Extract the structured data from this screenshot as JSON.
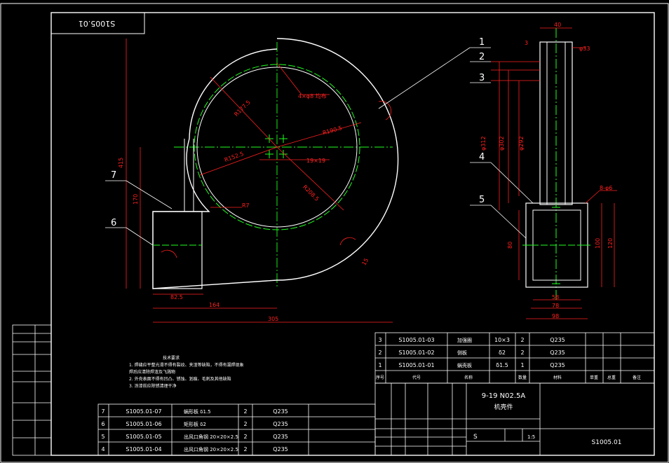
{
  "title_block_flipped": "S1005.01",
  "drawing_number": "S1005.01",
  "product": {
    "model": "9-19 N02.5A",
    "name": "机壳件"
  },
  "scale": "1:5",
  "material_mark": "S",
  "callouts": [
    "1",
    "2",
    "3",
    "4",
    "5",
    "6",
    "7"
  ],
  "dims_front": {
    "r_top": "R177.5",
    "r_mid": "R190.5",
    "r_left": "R152.5",
    "r_bot": "R208.5",
    "holes": "4×φ8 均布",
    "square": "19×19",
    "r7": "R7",
    "h415": "415",
    "h170": "170",
    "w82": "82.5",
    "w164": "164",
    "w305": "305",
    "ang15": "15"
  },
  "dims_side": {
    "w40": "40",
    "t3": "3",
    "pipe": "φ33",
    "d312": "φ312",
    "d302": "φ302",
    "d292": "φ292",
    "holes8": "8-φ6",
    "h80": "80",
    "h100": "100",
    "h120": "120",
    "w58": "58",
    "w78": "78",
    "w98": "98"
  },
  "notes": {
    "heading": "技术要求",
    "lines": [
      "1. 焊缝应平整光滑不得有裂纹、夹渣等缺陷，不得有漏焊现象",
      "   焊后应清除焊渣及飞溅物",
      "2. 外壳表面不得有凹凸、锈蚀、划痕、毛刺及其他缺陷",
      "3. 涂漆前应除锈清理干净"
    ]
  },
  "bom_upper": [
    {
      "no": "3",
      "code": "S1005.01-03",
      "name": "加强圈",
      "spec": "10×3",
      "qty": "2",
      "mat": "Q235"
    },
    {
      "no": "2",
      "code": "S1005.01-02",
      "name": "侧板",
      "spec": "δ2",
      "qty": "2",
      "mat": "Q235"
    },
    {
      "no": "1",
      "code": "S1005.01-01",
      "name": "蜗壳板",
      "spec": "δ1.5",
      "qty": "1",
      "mat": "Q235"
    }
  ],
  "bom_upper_header": [
    "序号",
    "代号",
    "名称",
    "数量",
    "材料",
    "单重",
    "总重",
    "备注"
  ],
  "bom_lower": [
    {
      "no": "7",
      "code": "S1005.01-07",
      "name": "蜗形板",
      "spec": "δ1.5",
      "qty": "2",
      "mat": "Q235"
    },
    {
      "no": "6",
      "code": "S1005.01-06",
      "name": "矩形板",
      "spec": "δ2",
      "qty": "2",
      "mat": "Q235"
    },
    {
      "no": "5",
      "code": "S1005.01-05",
      "name": "出风口角钢",
      "spec": "20×20×2.5",
      "qty": "2",
      "mat": "Q235"
    },
    {
      "no": "4",
      "code": "S1005.01-04",
      "name": "出风口角钢",
      "spec": "20×20×2.5",
      "qty": "2",
      "mat": "Q235"
    }
  ],
  "colors": {
    "frame": "#ffffff",
    "dim": "#ff2020",
    "center": "#20ff20",
    "part": "#ffffff"
  }
}
